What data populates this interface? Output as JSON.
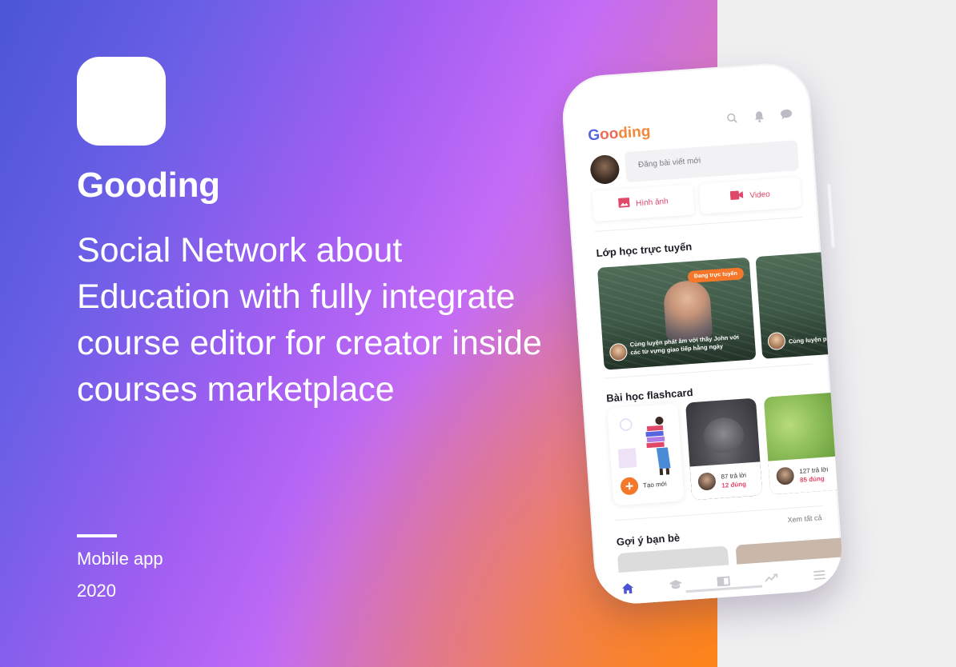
{
  "colors": {
    "accent_blue": "#4a55d6",
    "accent_orange": "#f4772a",
    "accent_pink": "#e0486a"
  },
  "hero": {
    "app_name": "Gooding",
    "tagline": "Social Network about Education with fully integrate course editor for creator inside courses marketplace",
    "platform": "Mobile app",
    "year": "2020"
  },
  "app": {
    "logo": {
      "g": "G",
      "oo": "oo",
      "rest": "ding"
    },
    "header_icons": [
      "search-icon",
      "bell-icon",
      "chat-icon"
    ],
    "compose_placeholder": "Đăng bài viết mới",
    "media_buttons": [
      {
        "label": "Hình ảnh",
        "icon": "image-icon"
      },
      {
        "label": "Video",
        "icon": "video-icon"
      }
    ],
    "online_classes": {
      "title": "Lớp học trực tuyến",
      "cards": [
        {
          "badge": "Đang trực tuyến",
          "caption": "Cùng luyện phát âm với thầy John với các từ vựng giao tiếp hằng ngày"
        },
        {
          "caption": "Cùng luyện phát âm với các từ vựng"
        }
      ]
    },
    "flashcards": {
      "title": "Bài học flashcard",
      "create_label": "Tạo mới",
      "cards": [
        {
          "answers": "87 trả lời",
          "correct": "12 đúng"
        },
        {
          "answers": "127 trả lời",
          "correct": "85 đúng"
        }
      ]
    },
    "friends": {
      "title": "Gợi ý bạn bè",
      "see_all": "Xem tất cả"
    },
    "nav": [
      "home-icon",
      "courses-icon",
      "book-icon",
      "trending-icon",
      "menu-icon"
    ]
  }
}
